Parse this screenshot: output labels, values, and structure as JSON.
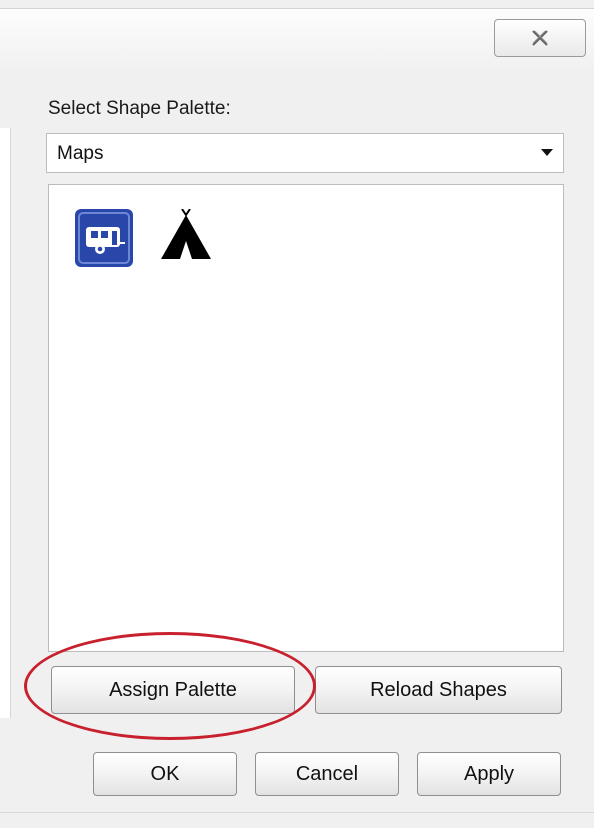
{
  "dialog": {
    "close_icon": "close-icon"
  },
  "palette": {
    "label": "Select Shape Palette:",
    "selected": "Maps",
    "shapes": [
      {
        "name": "rv-camper-icon"
      },
      {
        "name": "tent-icon"
      }
    ]
  },
  "buttons": {
    "assign_palette": "Assign Palette",
    "reload_shapes": "Reload Shapes",
    "ok": "OK",
    "cancel": "Cancel",
    "apply": "Apply"
  },
  "colors": {
    "highlight": "#c8202d",
    "rv_icon_bg": "#2947a8"
  }
}
